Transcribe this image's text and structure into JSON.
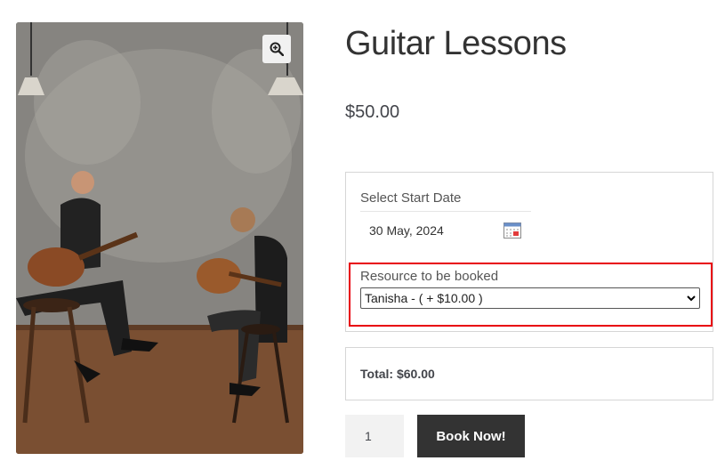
{
  "product": {
    "title": "Guitar Lessons",
    "price": "$50.00",
    "image_alt": "teacher and child playing guitars"
  },
  "icons": {
    "zoom": "magnifier-plus-icon",
    "calendar": "calendar-icon",
    "select_arrow": "chevron-down-icon"
  },
  "booking": {
    "start_date_label": "Select Start Date",
    "start_date_value": "30 May, 2024",
    "resource_label": "Resource to be booked",
    "resource_selected": "Tanisha - ( + $10.00 )",
    "total_label": "Total: $60.00"
  },
  "cart": {
    "quantity": "1",
    "book_button": "Book Now!"
  },
  "colors": {
    "highlight": "#e8000b",
    "button_bg": "#333333",
    "text": "#43454b"
  }
}
